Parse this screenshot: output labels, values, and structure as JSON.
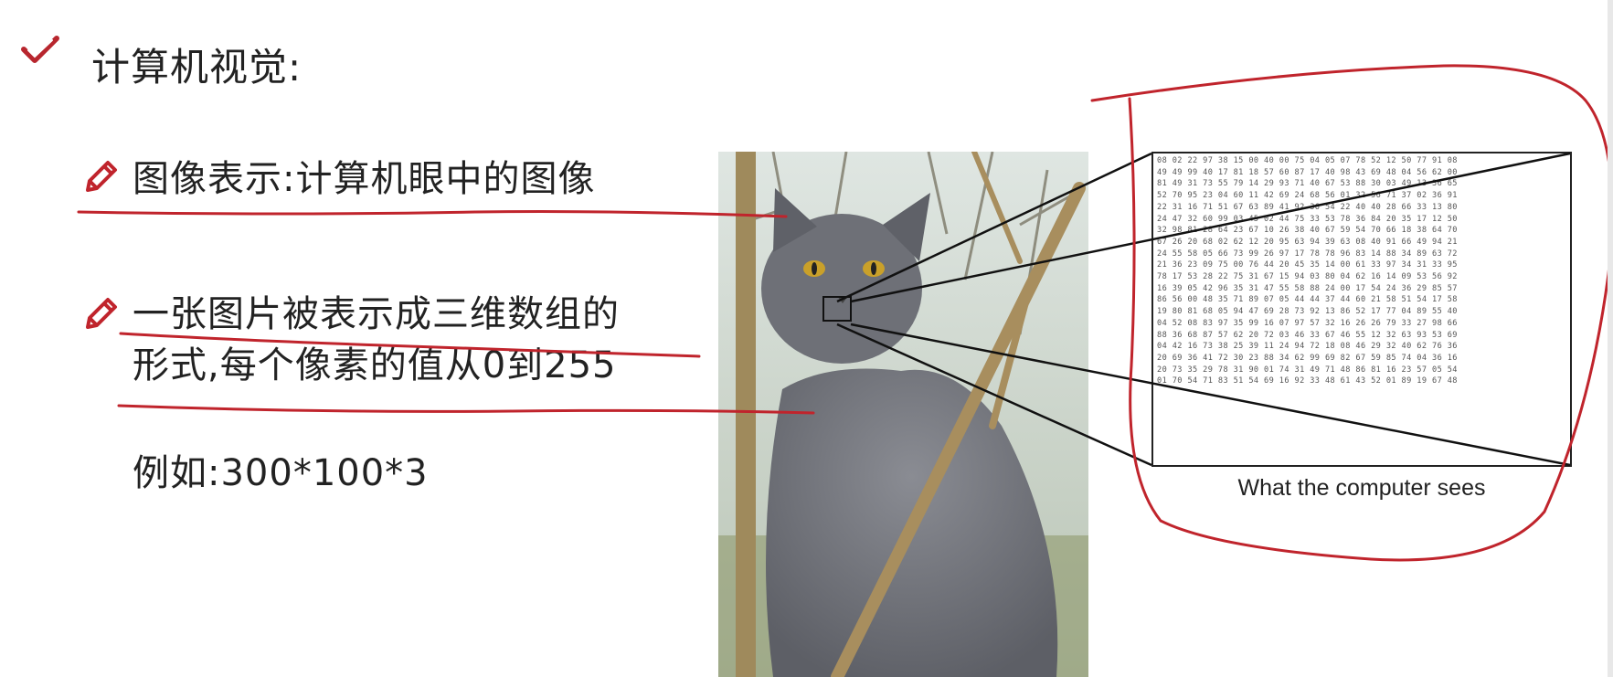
{
  "slide": {
    "title": "计算机视觉:",
    "bullets": [
      {
        "line1": "图像表示:计算机眼中的图像",
        "line2": ""
      },
      {
        "line1": "一张图片被表示成三维数组的",
        "line2": "形式,每个像素的值从0到255"
      }
    ],
    "example": "例如:300*100*3",
    "caption": "What the computer sees",
    "pixel_grid_rows": [
      "08 02 22 97 38 15 00 40 00 75 04 05 07 78 52 12 50 77 91 08",
      "49 49 99 40 17 81 18 57 60 87 17 40 98 43 69 48 04 56 62 00",
      "81 49 31 73 55 79 14 29 93 71 40 67 53 88 30 03 49 13 36 65",
      "52 70 95 23 04 60 11 42 69 24 68 56 01 32 56 71 37 02 36 91",
      "22 31 16 71 51 67 63 89 41 92 36 54 22 40 40 28 66 33 13 80",
      "24 47 32 60 99 03 45 02 44 75 33 53 78 36 84 20 35 17 12 50",
      "32 98 81 28 64 23 67 10 26 38 40 67 59 54 70 66 18 38 64 70",
      "67 26 20 68 02 62 12 20 95 63 94 39 63 08 40 91 66 49 94 21",
      "24 55 58 05 66 73 99 26 97 17 78 78 96 83 14 88 34 89 63 72",
      "21 36 23 09 75 00 76 44 20 45 35 14 00 61 33 97 34 31 33 95",
      "78 17 53 28 22 75 31 67 15 94 03 80 04 62 16 14 09 53 56 92",
      "16 39 05 42 96 35 31 47 55 58 88 24 00 17 54 24 36 29 85 57",
      "86 56 00 48 35 71 89 07 05 44 44 37 44 60 21 58 51 54 17 58",
      "19 80 81 68 05 94 47 69 28 73 92 13 86 52 17 77 04 89 55 40",
      "04 52 08 83 97 35 99 16 07 97 57 32 16 26 26 79 33 27 98 66",
      "88 36 68 87 57 62 20 72 03 46 33 67 46 55 12 32 63 93 53 69",
      "04 42 16 73 38 25 39 11 24 94 72 18 08 46 29 32 40 62 76 36",
      "20 69 36 41 72 30 23 88 34 62 99 69 82 67 59 85 74 04 36 16",
      "20 73 35 29 78 31 90 01 74 31 49 71 48 86 81 16 23 57 05 54",
      "01 70 54 71 83 51 54 69 16 92 33 48 61 43 52 01 89 19 67 48"
    ],
    "colors": {
      "accent": "#c0242c",
      "check": "#b8262e",
      "text": "#222222"
    },
    "icons": [
      "check-icon",
      "pencil-icon",
      "pencil-icon"
    ]
  }
}
